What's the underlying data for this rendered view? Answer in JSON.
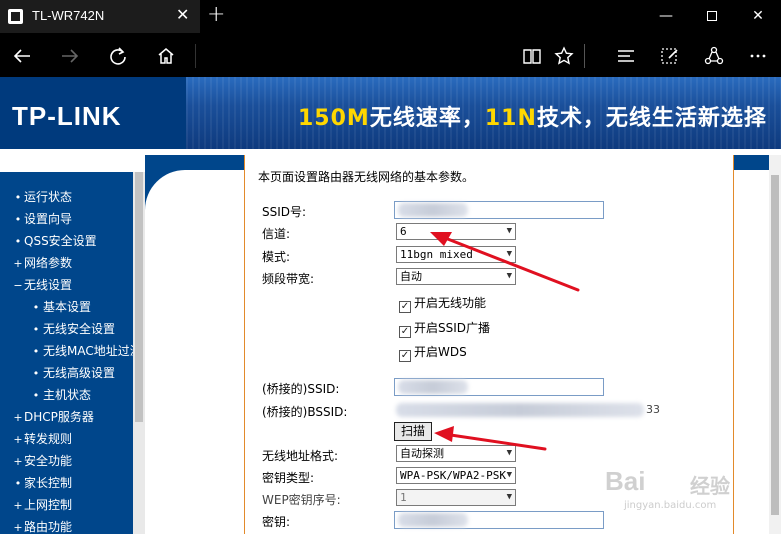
{
  "browser": {
    "tab_title": "TL-WR742N",
    "close_tab_glyph": "✕",
    "new_tab_glyph": "+",
    "window": {
      "minimize": "—",
      "close": "✕"
    }
  },
  "banner": {
    "logo": "TP-LINK",
    "slogan_part1": "150M",
    "slogan_part2": "无线速率，",
    "slogan_part3": "11N",
    "slogan_part4": "技术，无线生活新选择"
  },
  "sidebar": {
    "items": [
      {
        "label": "运行状态",
        "bullet": "•",
        "level": "top"
      },
      {
        "label": "设置向导",
        "bullet": "•",
        "level": "top"
      },
      {
        "label": "QSS安全设置",
        "bullet": "•",
        "level": "top"
      },
      {
        "label": "网络参数",
        "bullet": "+",
        "level": "top"
      },
      {
        "label": "无线设置",
        "bullet": "−",
        "level": "top"
      },
      {
        "label": "基本设置",
        "bullet": "•",
        "level": "sub"
      },
      {
        "label": "无线安全设置",
        "bullet": "•",
        "level": "sub"
      },
      {
        "label": "无线MAC地址过滤",
        "bullet": "•",
        "level": "sub"
      },
      {
        "label": "无线高级设置",
        "bullet": "•",
        "level": "sub"
      },
      {
        "label": "主机状态",
        "bullet": "•",
        "level": "sub"
      },
      {
        "label": "DHCP服务器",
        "bullet": "+",
        "level": "top"
      },
      {
        "label": "转发规则",
        "bullet": "+",
        "level": "top"
      },
      {
        "label": "安全功能",
        "bullet": "+",
        "level": "top"
      },
      {
        "label": "家长控制",
        "bullet": "•",
        "level": "top"
      },
      {
        "label": "上网控制",
        "bullet": "+",
        "level": "top"
      },
      {
        "label": "路由功能",
        "bullet": "+",
        "level": "top"
      }
    ]
  },
  "form": {
    "intro": "本页面设置路由器无线网络的基本参数。",
    "ssid_label": "SSID号:",
    "channel_label": "信道:",
    "channel_value": "6",
    "mode_label": "模式:",
    "mode_value": "11bgn mixed",
    "bandwidth_label": "频段带宽:",
    "bandwidth_value": "自动",
    "enable_wireless": "开启无线功能",
    "enable_ssid_broadcast": "开启SSID广播",
    "enable_wds": "开启WDS",
    "check_glyph": "✓",
    "bridge_ssid_label": "(桥接的)SSID:",
    "bridge_bssid_label": "(桥接的)BSSID:",
    "bridge_bssid_tail": "33",
    "scan_button": "扫描",
    "addr_format_label": "无线地址格式:",
    "addr_format_value": "自动探测",
    "key_type_label": "密钥类型:",
    "key_type_value": "WPA-PSK/WPA2-PSK",
    "wep_index_label": "WEP密钥序号:",
    "wep_index_value": "1",
    "key_label": "密钥:"
  },
  "watermark": {
    "brand": "Bai",
    "brand2": "经验",
    "url": "jingyan.baidu.com"
  },
  "colors": {
    "sidebar_bg": "#00468b",
    "panel_border": "#e28a2b",
    "arrow": "#e01020",
    "slogan_highlight": "#ffd700"
  }
}
